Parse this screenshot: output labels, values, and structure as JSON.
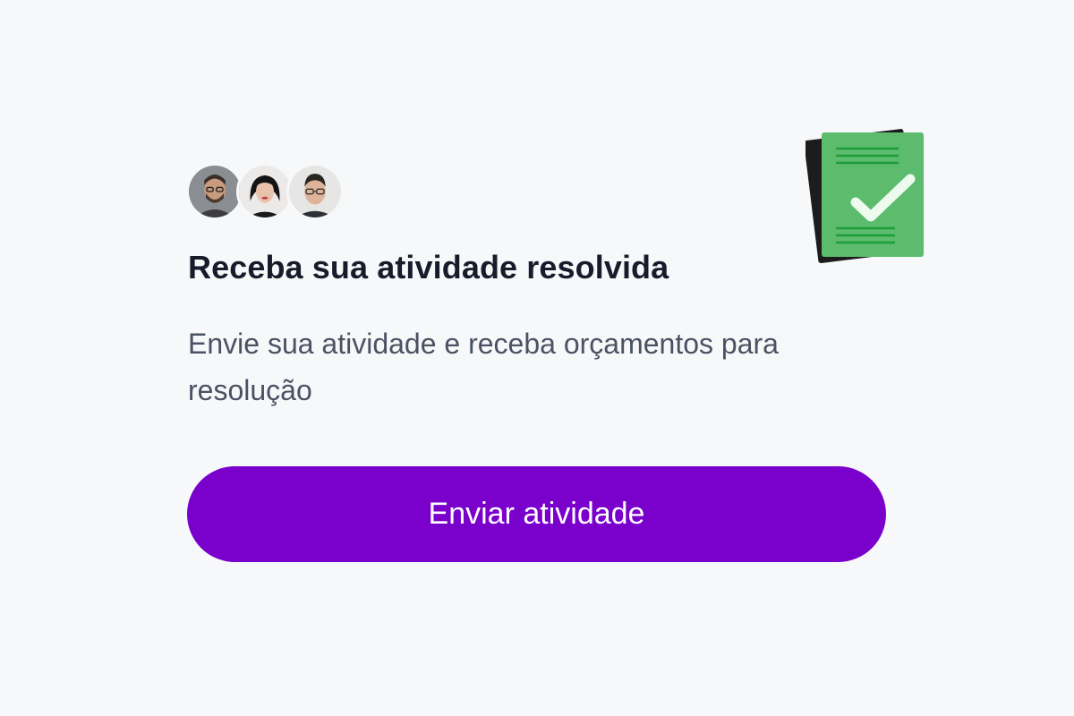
{
  "card": {
    "title": "Receba sua atividade resolvida",
    "subtitle": "Envie sua atividade e receba orçamentos para resolução",
    "cta_label": "Enviar atividade"
  },
  "avatars": [
    {
      "name": "avatar-man-beard"
    },
    {
      "name": "avatar-woman"
    },
    {
      "name": "avatar-man-glasses"
    }
  ],
  "illustration": {
    "icon": "document-check-icon"
  },
  "colors": {
    "background": "#f7f8fa",
    "title": "#171c2b",
    "subtitle": "#4a5263",
    "cta_background": "#7a00cc",
    "cta_text": "#ffffff",
    "document_green": "#5cbb6c",
    "document_back": "#1c1c1c",
    "document_lines": "#1e9c3a",
    "checkmark": "#ecfbee"
  }
}
